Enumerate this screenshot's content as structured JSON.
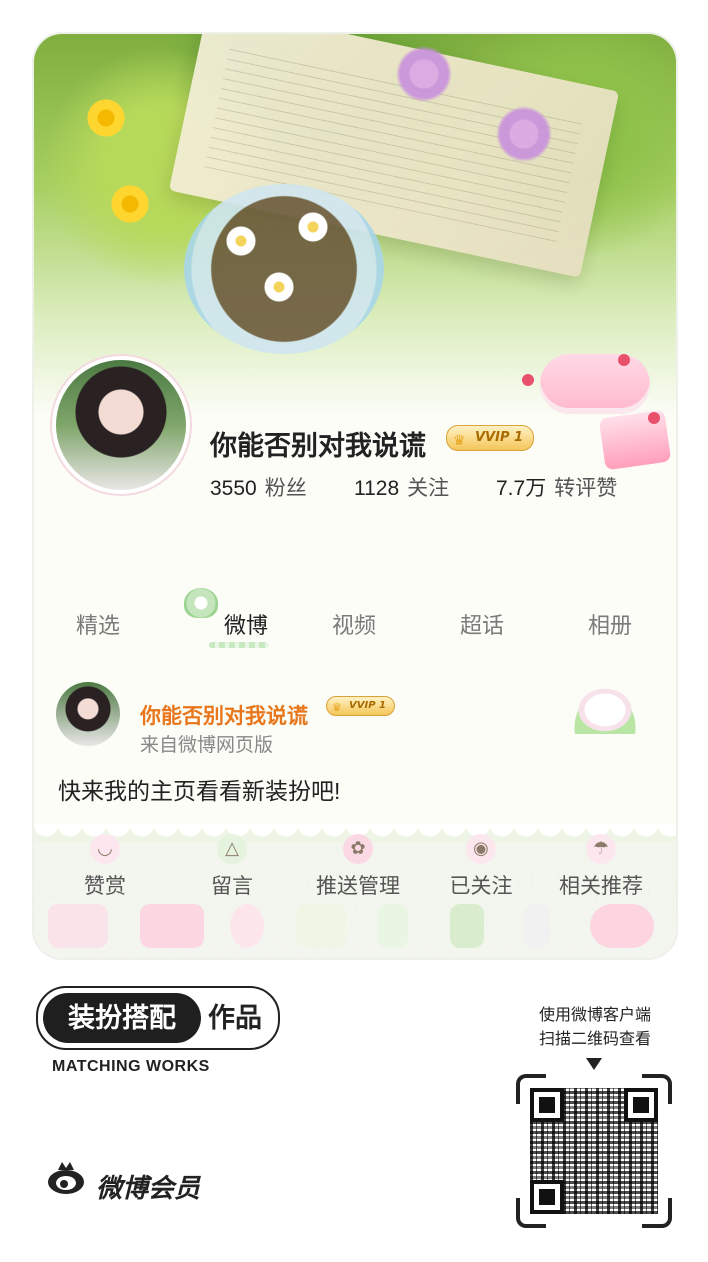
{
  "profile": {
    "username": "你能否别对我说谎",
    "vip_label": "VVIP 1",
    "stats": [
      {
        "value": "3550",
        "label": "粉丝"
      },
      {
        "value": "1128",
        "label": "关注"
      },
      {
        "value": "7.7万",
        "label": "转评赞"
      }
    ]
  },
  "tabs": [
    {
      "label": "精选"
    },
    {
      "label": "微博"
    },
    {
      "label": "视频"
    },
    {
      "label": "超话"
    },
    {
      "label": "相册"
    }
  ],
  "active_tab": "微博",
  "post": {
    "author": "你能否别对我说谎",
    "vip_label": "VVIP 1",
    "source": "来自微博网页版",
    "text": "快来我的主页看看新装扮吧!"
  },
  "actions": [
    {
      "label": "赞赏",
      "icon": "cup-icon"
    },
    {
      "label": "留言",
      "icon": "rice-ball-icon"
    },
    {
      "label": "推送管理",
      "icon": "rose-icon"
    },
    {
      "label": "已关注",
      "icon": "jar-icon"
    },
    {
      "label": "相关推荐",
      "icon": "umbrella-icon"
    }
  ],
  "footer": {
    "badge_dark": "装扮搭配",
    "badge_light": "作品",
    "subtitle": "MATCHING WORKS",
    "brand": "微博会员",
    "qr_caption_line1": "使用微博客户端",
    "qr_caption_line2": "扫描二维码查看"
  },
  "colors": {
    "accent_orange": "#e8761c",
    "vip_gold": "#f4c65a",
    "text_dark": "#222222",
    "text_muted": "#7b7b7b"
  }
}
